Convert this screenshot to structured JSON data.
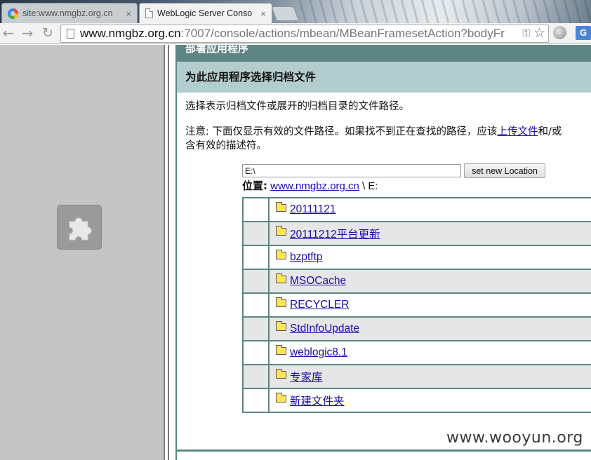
{
  "browser": {
    "tabs": [
      {
        "title": "site:www.nmgbz.org.cn",
        "icon": "google-favicon-icon",
        "active": false
      },
      {
        "title": "WebLogic Server Conso",
        "icon": "document-icon",
        "active": true
      }
    ],
    "close_glyph": "×",
    "url_host": "www.nmgbz.org.cn",
    "url_rest": ":7007/console/actions/mbean/MBeanFramesetAction?bodyFr",
    "back_glyph": "←",
    "forward_glyph": "→",
    "reload_glyph": "↻",
    "key_glyph": "⚿",
    "star_glyph": "☆",
    "translate_glyph": "G"
  },
  "left_frame": {
    "plugin_icon": "puzzle-piece-icon"
  },
  "page": {
    "header": "部署应用程序",
    "subheader": "为此应用程序选择归档文件",
    "intro": "选择表示归档文件或展开的归档目录的文件路径。",
    "note_prefix": "注意: 下面仅显示有效的文件路径。如果找不到正在查找的路径，应该",
    "note_link": "上传文件",
    "note_suffix": "和/或",
    "note_line2": "含有效的描述符。",
    "location_input_value": "E:\\",
    "set_location_button": "set new Location",
    "location_label": "位置:",
    "location_link": "www.nmgbz.org.cn",
    "location_suffix": " \\ E:",
    "folders": [
      "20111121",
      "20111212平台更新",
      "bzptftp",
      "MSOCache",
      "RECYCLER",
      "StdInfoUpdate",
      "weblogic8.1",
      "专家库",
      "新建文件夹"
    ]
  },
  "watermark": "www.wooyun.org",
  "colors": {
    "header_bg": "#5e8584",
    "subheader_bg": "#b3ccce",
    "link": "#1a0dab",
    "alt_row": "#e6e6e6"
  }
}
